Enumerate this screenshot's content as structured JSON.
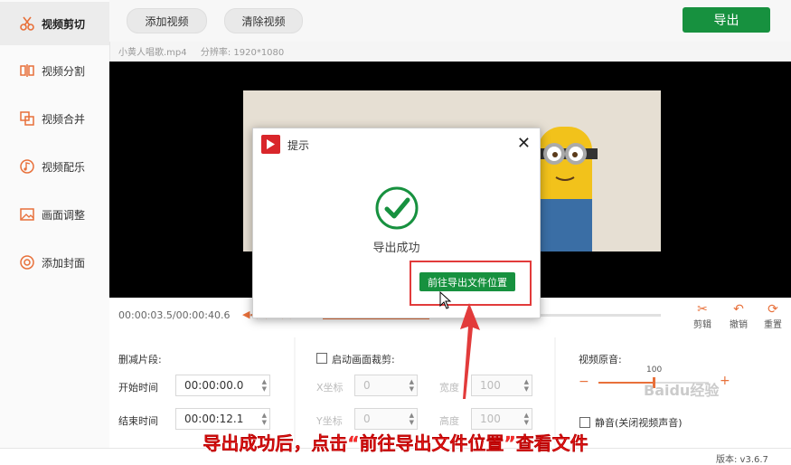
{
  "sidebar": {
    "items": [
      {
        "label": "视频剪切",
        "icon": "scissors-icon",
        "active": true
      },
      {
        "label": "视频分割",
        "icon": "split-icon",
        "active": false
      },
      {
        "label": "视频合并",
        "icon": "merge-icon",
        "active": false
      },
      {
        "label": "视频配乐",
        "icon": "music-icon",
        "active": false
      },
      {
        "label": "画面调整",
        "icon": "image-icon",
        "active": false
      },
      {
        "label": "添加封面",
        "icon": "cover-icon",
        "active": false
      }
    ]
  },
  "toolbar": {
    "add_video": "添加视频",
    "clear_video": "清除视频",
    "export": "导出"
  },
  "file": {
    "name": "小黄人唱歌.mp4",
    "resolution_label": "分辨率: 1920*1080"
  },
  "timeline": {
    "timecode": "00:00:03.5/00:00:40.6",
    "tools": [
      {
        "label": "剪辑",
        "icon": "cut-icon"
      },
      {
        "label": "撤销",
        "icon": "undo-icon"
      },
      {
        "label": "重置",
        "icon": "reset-icon"
      }
    ]
  },
  "trim": {
    "section_label": "删减片段:",
    "start_label": "开始时间",
    "start_value": "00:00:00.0",
    "end_label": "结束时间",
    "end_value": "00:00:12.1"
  },
  "crop": {
    "enable_label": "启动画面裁剪:",
    "x_label": "X坐标",
    "x_value": "0",
    "width_label": "宽度",
    "width_value": "100",
    "y_label": "Y坐标",
    "y_value": "0",
    "height_label": "高度",
    "height_value": "100"
  },
  "audio": {
    "section_label": "视频原音:",
    "volume": "100",
    "volume_fraction": 0.5,
    "mute_label": "静音(关闭视频声音)"
  },
  "dialog": {
    "title": "提示",
    "message": "导出成功",
    "goto_button": "前往导出文件位置"
  },
  "caption": "导出成功后，点击“前往导出文件位置”查看文件",
  "watermark": "Baidu经验",
  "bottom": {
    "version": "版本: v3.6.7"
  },
  "colors": {
    "accent_green": "#17913f",
    "accent_orange": "#e8703a",
    "highlight_red": "#e23b3b"
  }
}
